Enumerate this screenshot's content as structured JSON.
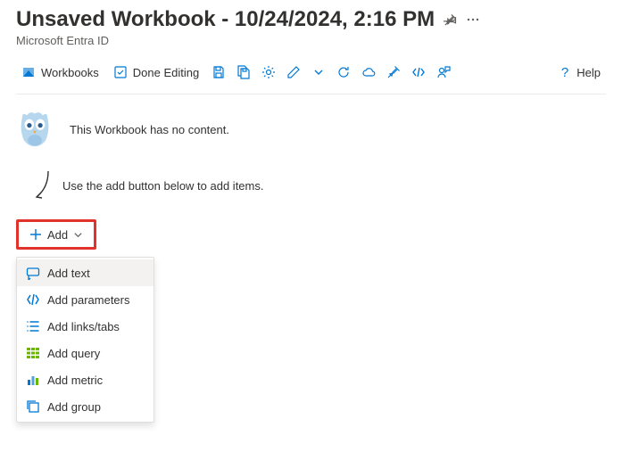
{
  "header": {
    "title": "Unsaved Workbook - 10/24/2024, 2:16 PM",
    "subtitle": "Microsoft Entra ID"
  },
  "toolbar": {
    "workbooks": "Workbooks",
    "done_editing": "Done Editing",
    "help": "Help"
  },
  "empty_state": {
    "no_content": "This Workbook has no content.",
    "hint": "Use the add button below to add items."
  },
  "add_button": {
    "label": "Add"
  },
  "add_menu": {
    "text": "Add text",
    "parameters": "Add parameters",
    "links": "Add links/tabs",
    "query": "Add query",
    "metric": "Add metric",
    "group": "Add group"
  }
}
